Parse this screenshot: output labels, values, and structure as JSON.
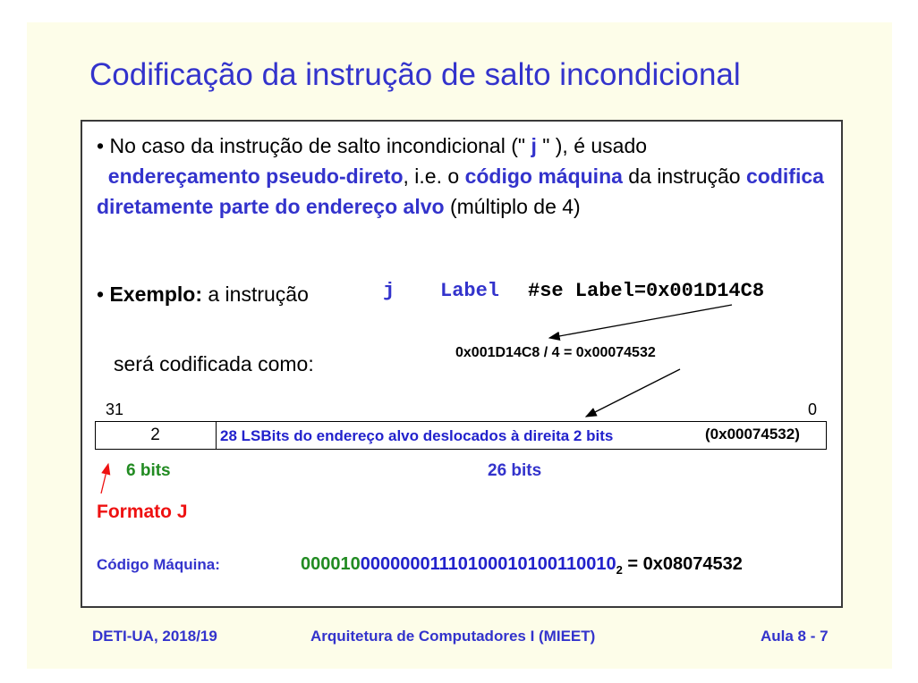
{
  "title": "Codificação da instrução de salto incondicional",
  "bullet1": {
    "bullet": "•",
    "t1": "No caso da instrução de salto incondicional (\" ",
    "j": "j",
    "t2": " \" ), é usado ",
    "hl1": "endereçamento pseudo-direto",
    "t3": ", i.e. o ",
    "hl2": "código máquina",
    "t4": " da instrução ",
    "hl3": "codifica diretamente parte do endereço alvo",
    "t5": " (múltiplo de 4)"
  },
  "bullet2": {
    "bullet": "•",
    "bold": "Exemplo:",
    "text": " a instrução",
    "code_j": "j",
    "code_label": "Label",
    "code_comment": "#se Label=0x001D14C8"
  },
  "calc": "0x001D14C8 / 4 = 0x00074532",
  "sera": "será codificada como:",
  "bits": {
    "left": "31",
    "right": "0"
  },
  "instruction": {
    "opcode": "2",
    "address_desc": "28 LSBits do endereço alvo deslocados à direita 2 bits",
    "address_hex": "(0x00074532)"
  },
  "fields": {
    "six": "6 bits",
    "twentysix": "26 bits"
  },
  "formato": "Formato J",
  "machine_code": {
    "label": "Código Máquina:",
    "opcode_bits": "000010",
    "address_bits": "00000001110100010100110010",
    "subscript": "2",
    "equals": " = 0x08074532"
  },
  "footer": {
    "left": "DETI-UA, 2018/19",
    "center": "Arquitetura de Computadores I (MIEET)",
    "right": "Aula 8 - 7"
  },
  "colors": {
    "title": "#3333cc",
    "highlight": "#3333cc",
    "opcode_green": "#228b22",
    "formato_red": "#e11111",
    "slide_bg": "#fdfde9"
  }
}
